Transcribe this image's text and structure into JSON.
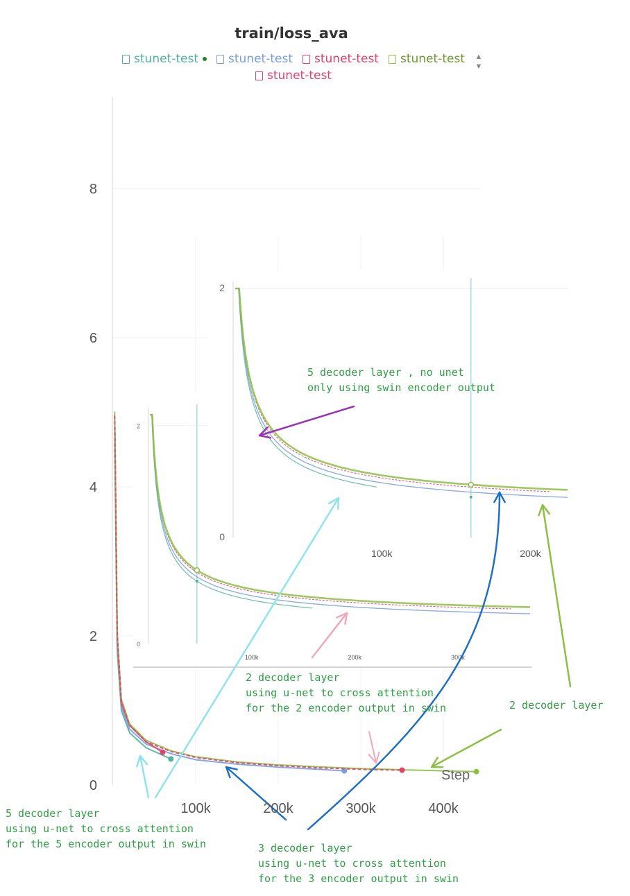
{
  "chart_data": {
    "type": "line",
    "title": "train/loss_ava",
    "xlabel": "Step",
    "ylabel": "",
    "xlim": [
      0,
      450000
    ],
    "ylim": [
      0,
      9
    ],
    "x_ticks": [
      "100k",
      "200k",
      "300k",
      "400k"
    ],
    "y_ticks": [
      "0",
      "2",
      "4",
      "6",
      "8"
    ],
    "grid": true,
    "legend_position": "top",
    "series": [
      {
        "name": "stunet-test",
        "color": "#4fb3a1",
        "x": [
          2000,
          5000,
          10000,
          20000,
          40000,
          70000
        ],
        "values": [
          4.6,
          1.8,
          1.0,
          0.7,
          0.5,
          0.35
        ]
      },
      {
        "name": "stunet-test",
        "color": "#7a9fe0",
        "x": [
          2000,
          5000,
          10000,
          20000,
          40000,
          70000,
          100000,
          150000,
          200000,
          250000,
          280000
        ],
        "values": [
          4.8,
          1.9,
          1.05,
          0.75,
          0.55,
          0.42,
          0.34,
          0.28,
          0.24,
          0.21,
          0.19
        ]
      },
      {
        "name": "stunet-test",
        "color": "#e0436f",
        "x": [
          2000,
          5000,
          10000,
          20000,
          40000,
          60000
        ],
        "values": [
          4.9,
          2.0,
          1.1,
          0.8,
          0.58,
          0.44
        ]
      },
      {
        "name": "stunet-test",
        "color": "#8dbf45",
        "x": [
          2000,
          5000,
          10000,
          20000,
          40000,
          70000,
          100000,
          150000,
          200000,
          300000,
          400000,
          440000
        ],
        "values": [
          5.0,
          2.05,
          1.15,
          0.82,
          0.6,
          0.46,
          0.38,
          0.31,
          0.27,
          0.22,
          0.19,
          0.18
        ]
      },
      {
        "name": "stunet-test",
        "color": "#e0436f",
        "x": [
          2000,
          5000,
          10000,
          20000,
          40000,
          70000,
          100000,
          150000,
          200000,
          250000,
          300000,
          350000
        ],
        "values": [
          4.95,
          2.02,
          1.12,
          0.8,
          0.58,
          0.45,
          0.37,
          0.3,
          0.26,
          0.23,
          0.21,
          0.2
        ]
      }
    ],
    "insets": [
      {
        "x_ticks": [
          "100k",
          "200k",
          "300k"
        ],
        "y_ticks": [
          "0",
          "2"
        ],
        "xlim": [
          0,
          370000
        ],
        "ylim": [
          0,
          2.1
        ]
      },
      {
        "x_ticks": [
          "100k",
          "200k"
        ],
        "y_ticks": [
          "0",
          "2"
        ],
        "xlim": [
          0,
          225000
        ],
        "ylim": [
          0,
          2.0
        ]
      }
    ]
  },
  "legend": {
    "row1": [
      "stunet-test",
      "stunet-test",
      "stunet-test",
      "stunet-test"
    ],
    "row2": [
      "stunet-test"
    ],
    "colors": [
      "#4fb3a1",
      "#7a9fe0",
      "#e0436f",
      "#8dbf45",
      "#e0436f"
    ]
  },
  "annotations": {
    "note_5_no_unet": "5 decoder layer , no unet\nonly using swin encoder output",
    "note_2_unet": "2 decoder layer\nusing u-net to cross attention\nfor the 2 encoder output in swin",
    "note_2_layer": "2 decoder layer",
    "note_5_unet": "5 decoder layer\nusing u-net to cross attention\nfor the 5 encoder output in swin",
    "note_3_unet": "3 decoder layer\nusing u-net to cross attention\nfor the 3 encoder output in swin"
  }
}
